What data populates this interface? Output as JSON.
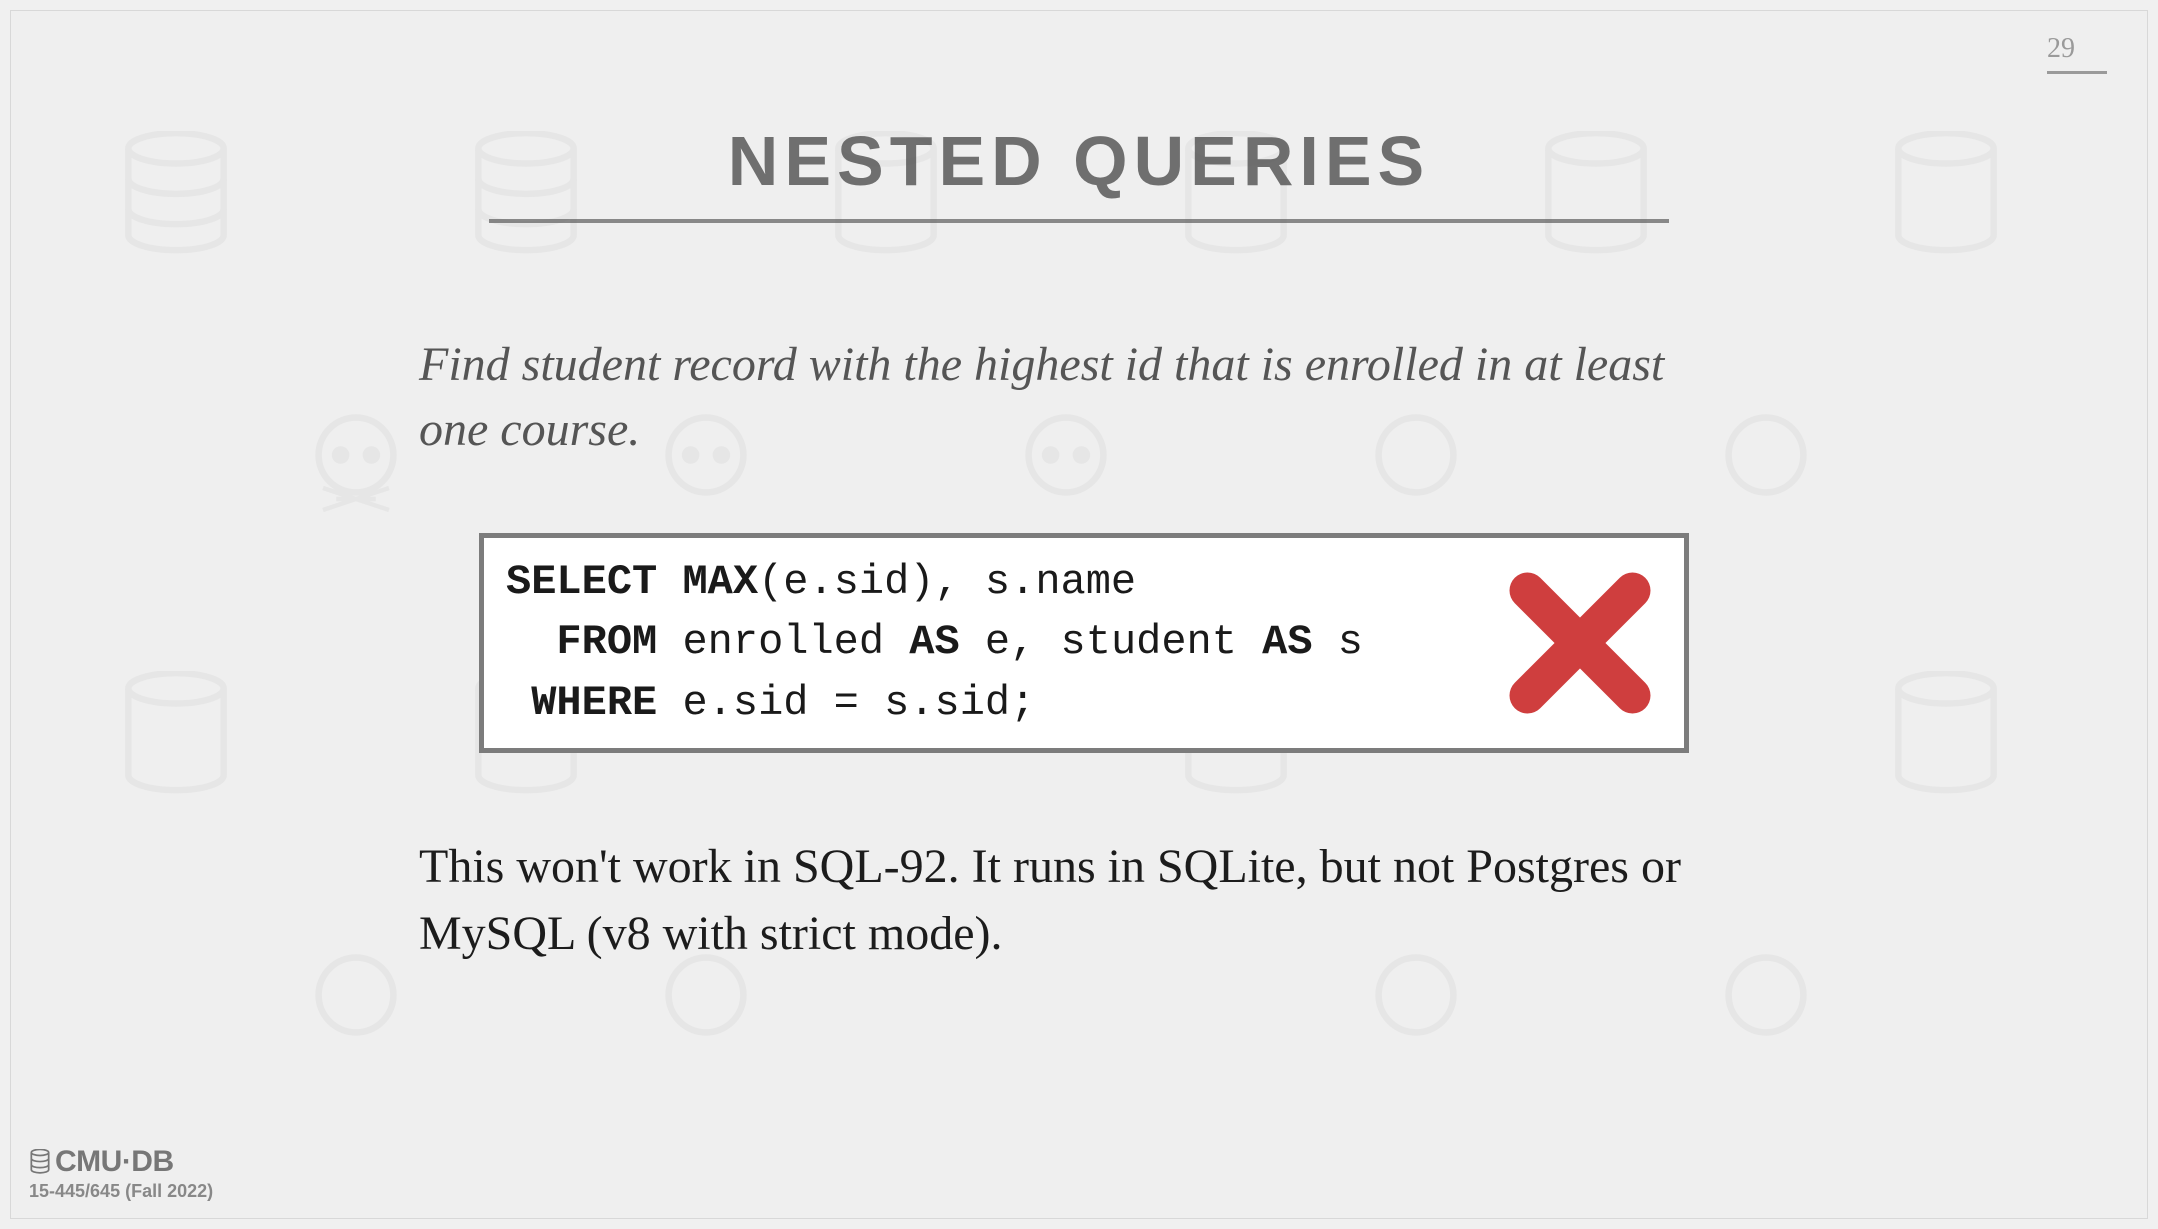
{
  "page_number": "29",
  "title": "NESTED QUERIES",
  "prompt": "Find student record with the highest id that is enrolled in at least one course.",
  "code": {
    "line1_kw1": "SELECT",
    "line1_kw2": "MAX",
    "line1_rest": "(e.sid), s.name",
    "line2_kw1": "FROM",
    "line2_txt1": " enrolled ",
    "line2_kw2": "AS",
    "line2_txt2": " e, student ",
    "line2_kw3": "AS",
    "line2_txt3": " s",
    "line3_kw1": "WHERE",
    "line3_rest": " e.sid = s.sid;"
  },
  "explain": "This won't work in SQL-92. It runs in SQLite, but not Postgres or MySQL (v8 with strict mode).",
  "footer": {
    "logo_text": "CMU·DB",
    "course": "15-445/645 (Fall 2022)"
  }
}
